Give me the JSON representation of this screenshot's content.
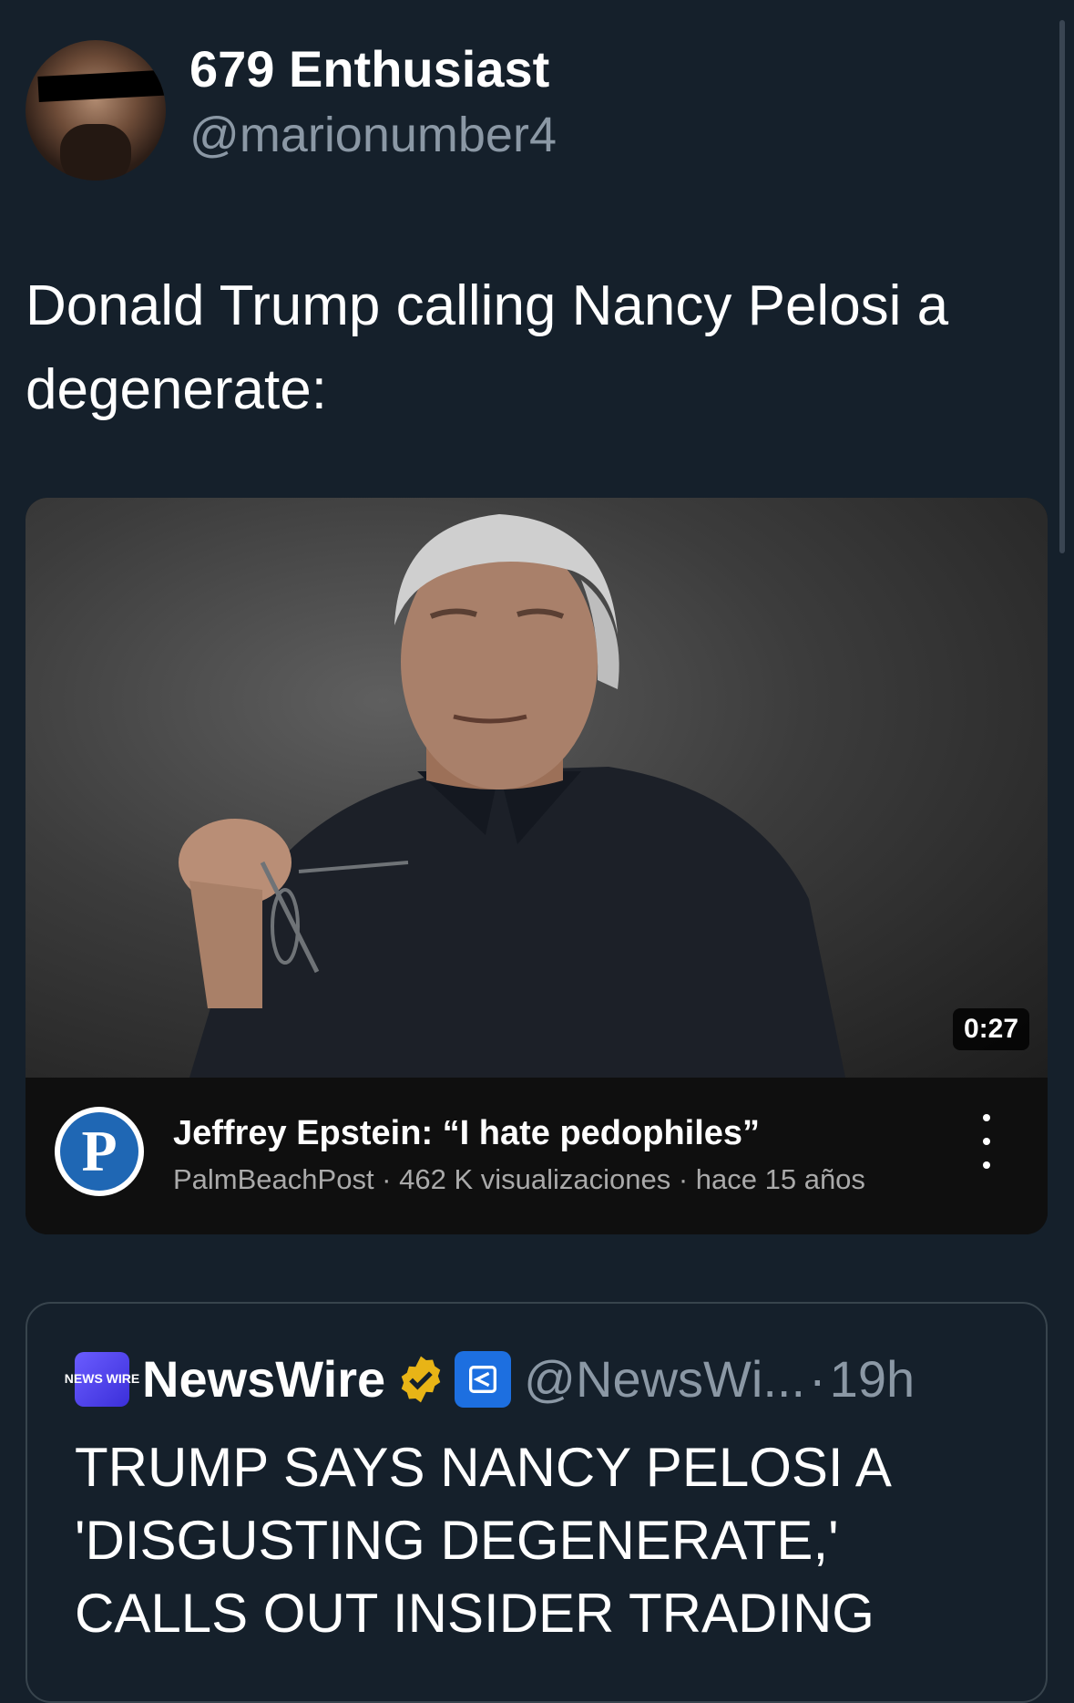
{
  "author": {
    "display_name": "679 Enthusiast",
    "handle": "@marionumber4"
  },
  "tweet": {
    "text": "Donald Trump calling Nancy Pelosi a degenerate:"
  },
  "video": {
    "duration": "0:27",
    "title": "Jeffrey Epstein: “I hate pedophiles”",
    "meta": "PalmBeachPost · 462 K visualizaciones · hace 15 años",
    "channel_logo_letter": "P",
    "channel_logo_color": "#1f67b4"
  },
  "quoted": {
    "logo_text": "NEWS WIRE",
    "name": "NewsWire",
    "handle": "@NewsWi...",
    "separator": "·",
    "time": "19h",
    "text": "TRUMP SAYS NANCY PELOSI A 'DISGUSTING DEGENERATE,' CALLS OUT INSIDER TRADING",
    "verified_badge_color": "#e8b416",
    "affiliate_badge_color": "#1d6fe0"
  },
  "icons": {
    "verified": "verified-badge-icon",
    "affiliate": "affiliate-badge-icon",
    "more": "more-vertical-icon"
  }
}
